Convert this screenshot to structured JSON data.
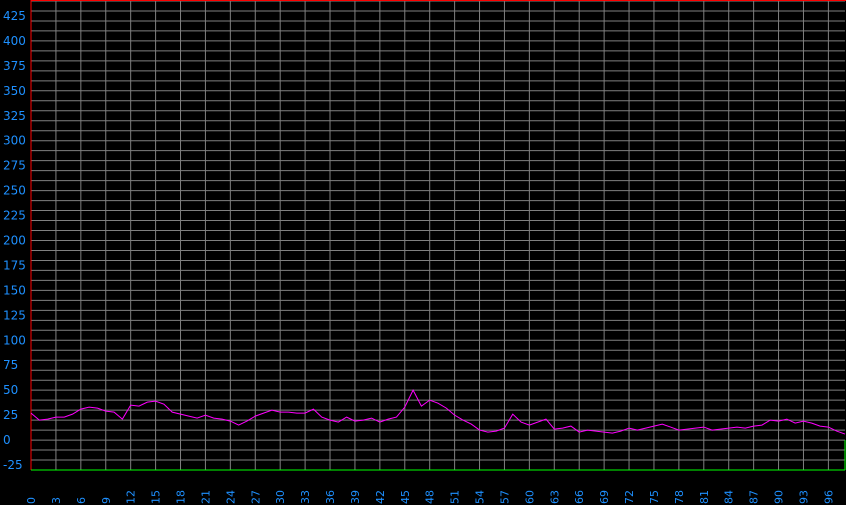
{
  "chart_data": {
    "type": "line",
    "title": "",
    "xlabel": "",
    "ylabel": "",
    "xlim": [
      0,
      98
    ],
    "ylim": [
      -30,
      440
    ],
    "grid": true,
    "y_ticks": [
      425,
      400,
      375,
      350,
      325,
      300,
      275,
      250,
      225,
      200,
      175,
      150,
      125,
      100,
      75,
      50,
      25,
      0,
      -25
    ],
    "x_ticks": [
      0,
      3,
      6,
      9,
      12,
      15,
      18,
      21,
      24,
      27,
      30,
      33,
      36,
      39,
      42,
      45,
      48,
      51,
      54,
      57,
      60,
      63,
      66,
      69,
      72,
      75,
      78,
      81,
      84,
      87,
      90,
      93,
      96
    ],
    "colors": {
      "background": "#000000",
      "grid": "#808080",
      "tick_label": "#1E90FF",
      "series": "#FF00FF",
      "top_border": "#FF0000",
      "baseline": "#00FF00"
    },
    "series": [
      {
        "values": [
          27,
          20,
          21,
          23,
          23,
          26,
          31,
          33,
          32,
          29,
          28,
          21,
          35,
          34,
          38,
          39,
          36,
          28,
          26,
          24,
          22,
          25,
          22,
          21,
          19,
          15,
          19,
          24,
          27,
          30,
          28,
          28,
          27,
          27,
          31,
          23,
          20,
          18,
          23,
          19,
          20,
          22,
          18,
          21,
          23,
          33,
          50,
          34,
          40,
          37,
          32,
          25,
          20,
          16,
          10,
          8,
          9,
          12,
          26,
          18,
          15,
          18,
          21,
          11,
          12,
          14,
          8,
          10,
          9,
          8,
          7,
          9,
          12,
          10,
          12,
          14,
          16,
          13,
          10,
          11,
          12,
          13,
          10,
          11,
          12,
          13,
          12,
          14,
          15,
          20,
          19,
          21,
          17,
          19,
          17,
          14,
          13,
          9,
          6
        ]
      }
    ]
  }
}
